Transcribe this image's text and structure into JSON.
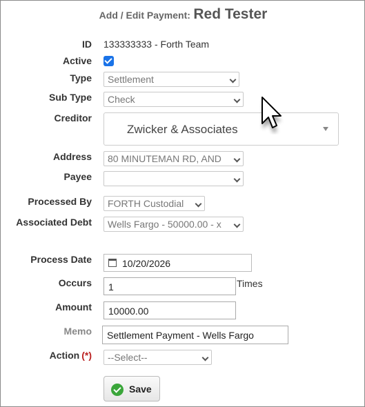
{
  "header": {
    "prefix": "Add / Edit Payment:",
    "name": "Red Tester"
  },
  "form": {
    "id": {
      "label": "ID",
      "value": "133333333 - Forth Team"
    },
    "active": {
      "label": "Active",
      "checked": true
    },
    "type": {
      "label": "Type",
      "value": "Settlement"
    },
    "sub_type": {
      "label": "Sub Type",
      "value": "Check"
    },
    "creditor": {
      "label": "Creditor",
      "value": "Zwicker & Associates"
    },
    "address": {
      "label": "Address",
      "value": "80 MINUTEMAN RD, AND"
    },
    "payee": {
      "label": "Payee",
      "value": ""
    },
    "processed_by": {
      "label": "Processed By",
      "value": "FORTH Custodial"
    },
    "associated_debt": {
      "label": "Associated Debt",
      "value": "Wells Fargo - 50000.00 - x"
    },
    "process_date": {
      "label": "Process Date",
      "value": "10/20/2026"
    },
    "occurs": {
      "label": "Occurs",
      "value": "1",
      "suffix": "Times"
    },
    "amount": {
      "label": "Amount",
      "value": "10000.00"
    },
    "memo": {
      "label": "Memo",
      "value": "Settlement Payment - Wells Fargo"
    },
    "action": {
      "label": "Action",
      "required_mark": "(*)",
      "value": "--Select--"
    }
  },
  "buttons": {
    "save": "Save"
  },
  "icons": {
    "checkbox": "checkbox-checked-icon",
    "calendar": "calendar-icon",
    "save": "check-circle-icon",
    "cursor": "mouse-pointer-icon"
  },
  "colors": {
    "accent": "#1a73e8",
    "save_icon": "#3aa63a",
    "required": "#b22222"
  }
}
